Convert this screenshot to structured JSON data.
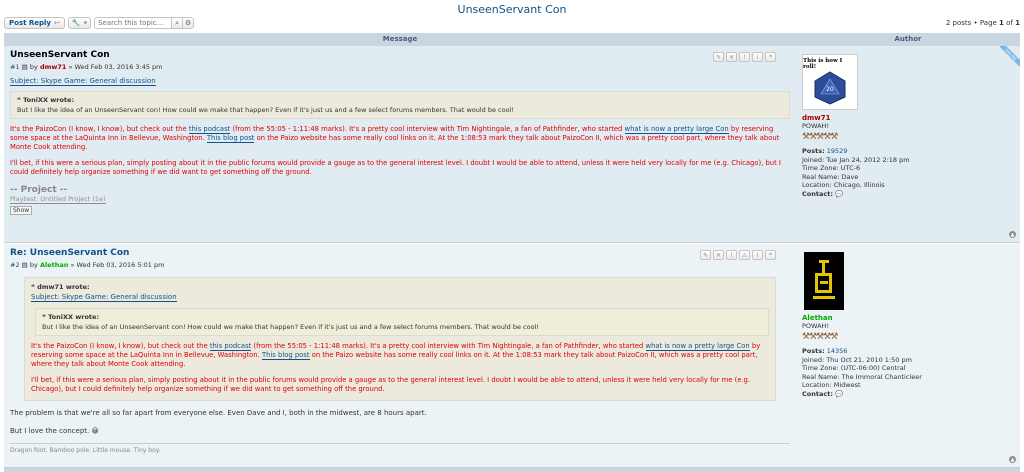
{
  "page": {
    "title": "UnseenServant Con"
  },
  "toolbar": {
    "post_reply": "Post Reply",
    "search_placeholder": "Search this topic…",
    "pagination_prefix": "2 posts • Page ",
    "page_current": "1",
    "page_of": " of ",
    "page_total": "1"
  },
  "table_head": {
    "message": "Message",
    "author": "Author"
  },
  "posts": [
    {
      "title": "UnseenServant Con",
      "num": "#1",
      "by": "by",
      "author": "dmw71",
      "date": "» Wed Feb 03, 2016 3:45 pm",
      "subject": "Subject: Skype Game: General discussion",
      "quote_author": "ToniXX wrote:",
      "quote_text": "But I like the idea of an UnseenServant con! How could we make that happen? Even if it's just us and a few select forums members. That would be cool!",
      "p1_a": "It's the PaizoCon (I know, I know), but check out the ",
      "p1_link1": "this podcast",
      "p1_b": " (from the 55:05 - 1:11:48 marks). It's a pretty cool interview with Tim Nightingale, a fan of Pathfinder, who started ",
      "p1_link2": "what is now a pretty large Con",
      "p1_c": " by reserving some space at the LaQuinta Inn in Bellevue, Washington. ",
      "p1_link3": "This blog post",
      "p1_d": " on the Paizo website has some really cool links on it. At the 1:08:53 mark they talk about PaizoCon II, which was a pretty cool part, where they talk about Monte Cook attending.",
      "p2": "I'll bet, if this were a serious plan, simply posting about it in the public forums would provide a gauge as to the general interest level. I doubt I would be able to attend, unless it were held very locally for me (e.g. Chicago), but I could definitely help organize something if we did want to get something off the ground.",
      "project": "-- Project --",
      "project_sub": "Playtest: Untitled Project (1e)",
      "show": "Show",
      "online_badge": "ONLINE",
      "avatar_caption": "This is how I roll!",
      "user_title": "POWAH!",
      "posts_label": "Posts:",
      "posts_count": "19529",
      "joined": "Joined: Tue Jan 24, 2012 2:18 pm",
      "timezone": "Time Zone: UTC-6",
      "realname": "Real Name: Dave",
      "location": "Location: Chicago, Illinois",
      "contact": "Contact:"
    },
    {
      "title": "Re: UnseenServant Con",
      "num": "#2",
      "by": "by",
      "author": "Alethan",
      "date": "» Wed Feb 03, 2016 5:01 pm",
      "quote_author": "dmw71 wrote:",
      "quote_subject": "Subject: Skype Game: General discussion",
      "inner_quote_author": "ToniXX wrote:",
      "inner_quote_text": "But I like the idea of an UnseenServant con! How could we make that happen? Even if it's just us and a few select forums members. That would be cool!",
      "reply_text": "The problem is that we're all so far apart from everyone else. Even Dave and I, both in the midwest, are 8 hours apart.",
      "reply_text2": "But I love the concept. 😀",
      "signature": "Dragon foot. Bamboo pole. Little mouse. Tiny boy.",
      "user_title": "POWAH!",
      "posts_label": "Posts:",
      "posts_count": "14356",
      "joined": "Joined: Thu Oct 21, 2010 1:50 pm",
      "timezone": "Time Zone: (UTC-06:00) Central",
      "realname": "Real Name: The Immoral Chanticleer",
      "location": "Location: Midwest",
      "contact": "Contact:"
    }
  ],
  "colors": {
    "link": "#105289",
    "quote_bg": "#ebeadd",
    "red_text": "#e00000",
    "post1_bg": "#e1ebf2",
    "post2_bg": "#ecf3f7"
  }
}
